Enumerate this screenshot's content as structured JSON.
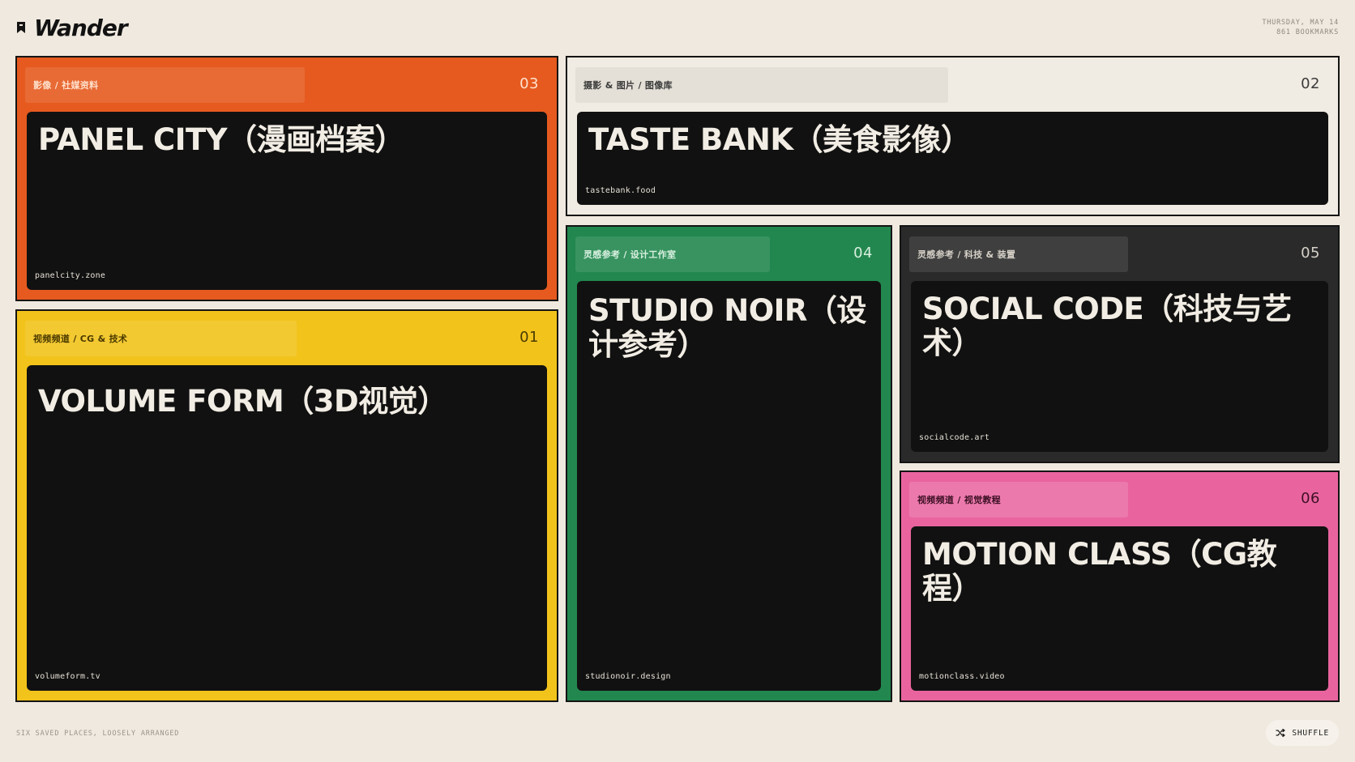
{
  "header": {
    "logo": "Wander",
    "date": "THURSDAY, MAY 14",
    "bookmark_count": "861 BOOKMARKS"
  },
  "cards": [
    {
      "number": "03",
      "tags": "影像 / 社媒资料",
      "title": "PANEL CITY（漫画档案）",
      "domain": "panelcity.zone",
      "color": "#e65a1f",
      "text_color": "#ffe1cc"
    },
    {
      "number": "02",
      "tags": "摄影 & 图片 / 图像库",
      "title": "TASTE BANK（美食影像）",
      "domain": "tastebank.food",
      "color": "#f1ece3",
      "text_color": "#3a3a3a"
    },
    {
      "number": "01",
      "tags": "视频频道 / CG & 技术",
      "title": "VOLUME FORM（3D视觉）",
      "domain": "volumeform.tv",
      "color": "#f2c31b",
      "text_color": "#4a3a00"
    },
    {
      "number": "04",
      "tags": "灵感参考 / 设计工作室",
      "title": "STUDIO NOIR（设计参考）",
      "domain": "studionoir.design",
      "color": "#22874e",
      "text_color": "#d8f0e0"
    },
    {
      "number": "05",
      "tags": "灵感参考 / 科技 & 装置",
      "title": "SOCIAL CODE（科技与艺术）",
      "domain": "socialcode.art",
      "color": "#2a2a2a",
      "text_color": "#d6d1c8"
    },
    {
      "number": "06",
      "tags": "视频频道 / 视觉教程",
      "title": "MOTION CLASS（CG教程）",
      "domain": "motionclass.video",
      "color": "#e9649f",
      "text_color": "#3d1024"
    }
  ],
  "footer": {
    "note": "SIX SAVED PLACES, LOOSELY ARRANGED",
    "shuffle_label": "SHUFFLE"
  }
}
